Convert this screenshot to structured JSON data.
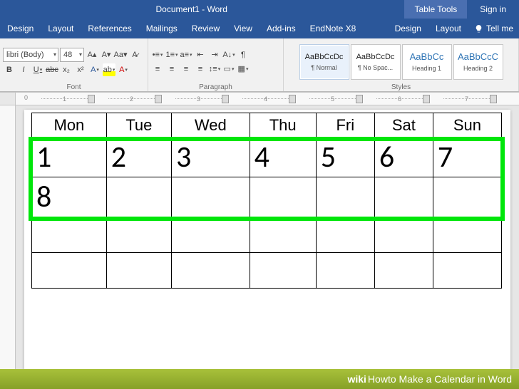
{
  "title": {
    "doc": "Document1  -  Word",
    "tableTools": "Table Tools",
    "signin": "Sign in"
  },
  "tabs": [
    "Design",
    "Layout",
    "References",
    "Mailings",
    "Review",
    "View",
    "Add-ins",
    "EndNote X8"
  ],
  "ttTabs": [
    "Design",
    "Layout"
  ],
  "tellme": "Tell me",
  "font": {
    "name": "libri (Body)",
    "size": "48"
  },
  "groups": {
    "font": "Font",
    "paragraph": "Paragraph",
    "styles": "Styles"
  },
  "styles": [
    {
      "preview": "AaBbCcDc",
      "name": "¶ Normal"
    },
    {
      "preview": "AaBbCcDc",
      "name": "¶ No Spac..."
    },
    {
      "preview": "AaBbCc",
      "name": "Heading 1"
    },
    {
      "preview": "AaBbCcC",
      "name": "Heading 2"
    }
  ],
  "calendar": {
    "days": [
      "Mon",
      "Tue",
      "Wed",
      "Thu",
      "Fri",
      "Sat",
      "Sun"
    ],
    "rows": [
      [
        "1",
        "2",
        "3",
        "4",
        "5",
        "6",
        "7"
      ],
      [
        "8",
        "",
        "",
        "",
        "",
        "",
        ""
      ],
      [
        "",
        "",
        "",
        "",
        "",
        "",
        ""
      ],
      [
        "",
        "",
        "",
        "",
        "",
        "",
        ""
      ]
    ]
  },
  "watermark": {
    "wiki": "wiki",
    "how": "How ",
    "tail": "to Make a Calendar in Word"
  }
}
